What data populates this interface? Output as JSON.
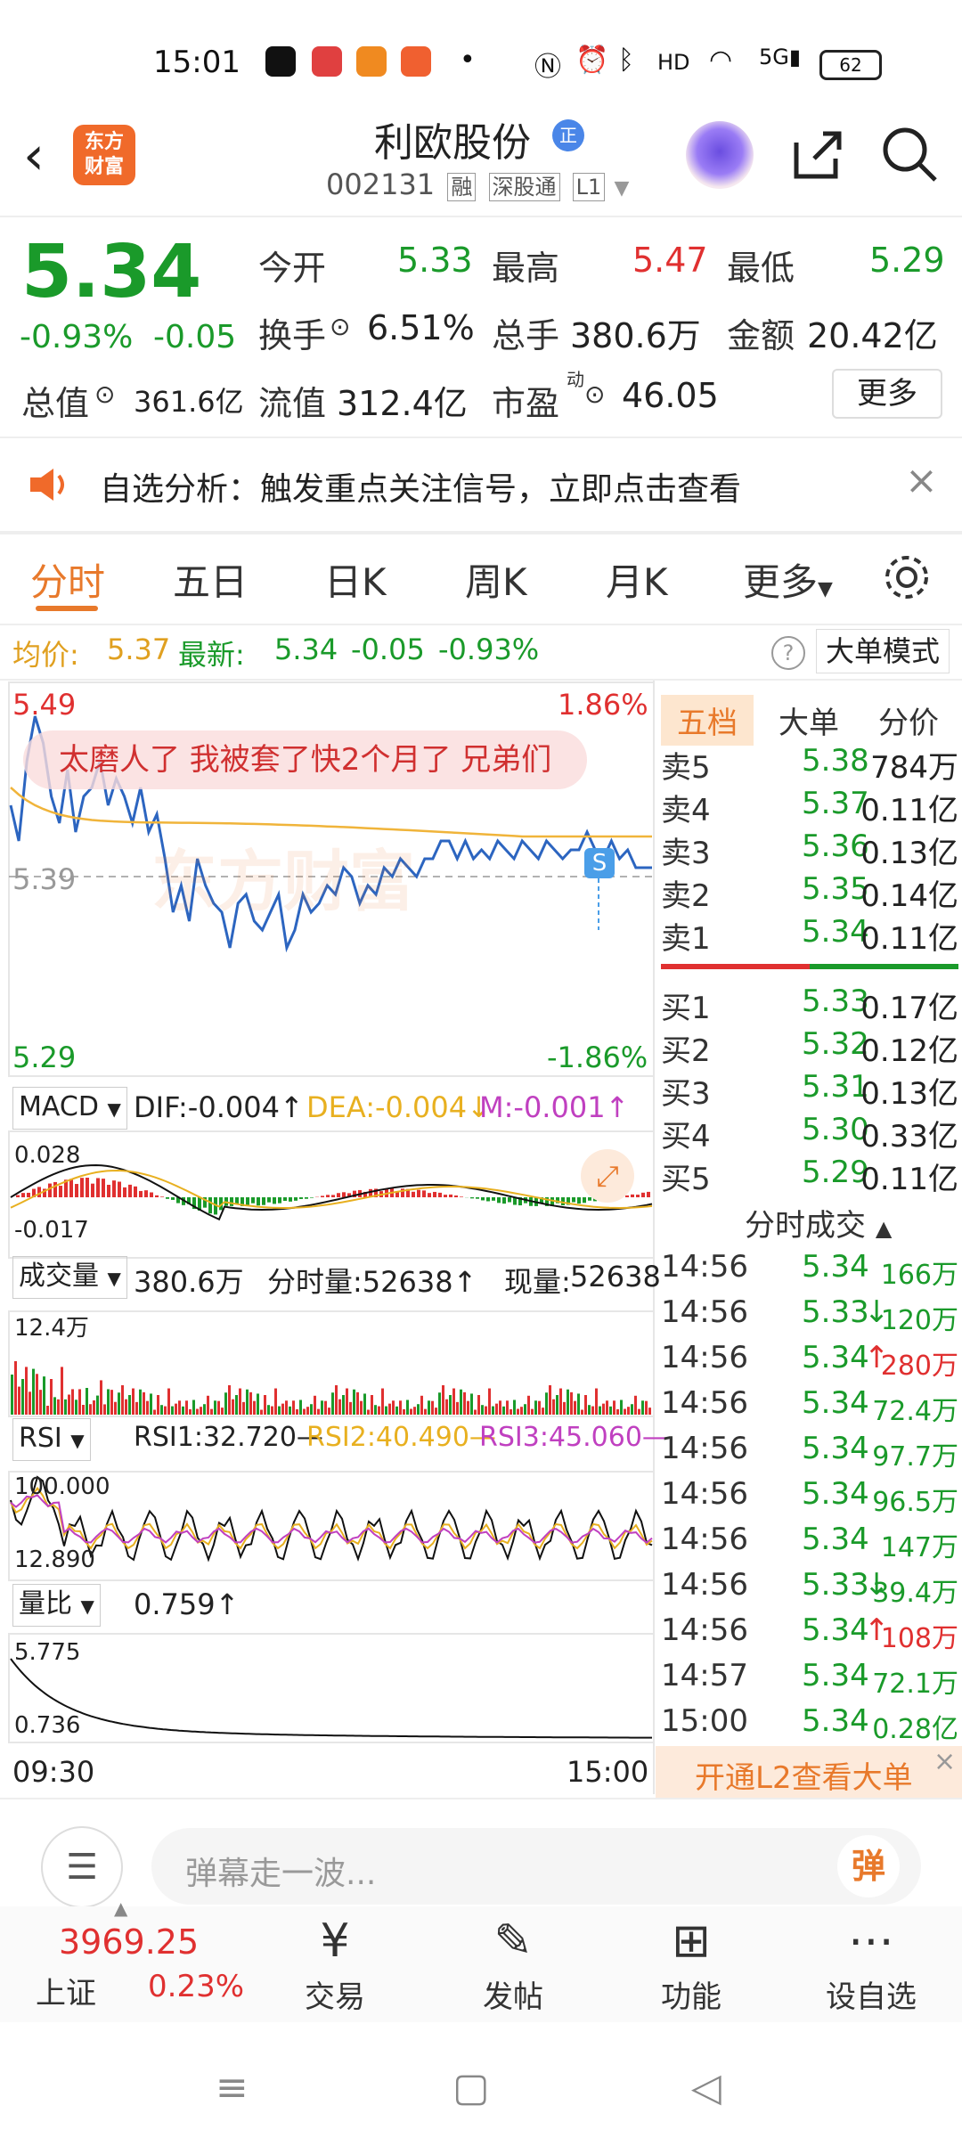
{
  "status_bar": {
    "time": "15:01",
    "battery": "62"
  },
  "header": {
    "stock_name": "利欧股份",
    "badge": "正",
    "stock_code": "002131",
    "tags": [
      "融",
      "深股通",
      "L1"
    ],
    "logo_text": "东方\n财富"
  },
  "quote": {
    "price": "5.34",
    "change_pct": "-0.93%",
    "change": "-0.05",
    "today_open_label": "今开",
    "today_open": "5.33",
    "high_label": "最高",
    "high": "5.47",
    "low_label": "最低",
    "low": "5.29",
    "turnover_label": "换手",
    "turnover": "6.51%",
    "volume_label": "总手",
    "volume": "380.6万",
    "amount_label": "金额",
    "amount": "20.42亿",
    "total_value_label": "总值",
    "total_value": "361.6亿",
    "float_value_label": "流值",
    "float_value": "312.4亿",
    "pe_label": "市盈",
    "pe_sup": "动",
    "pe": "46.05",
    "more": "更多"
  },
  "alert": {
    "text": "自选分析：触发重点关注信号，立即点击查看"
  },
  "tabs": [
    "分时",
    "五日",
    "日K",
    "周K",
    "月K",
    "更多"
  ],
  "info_line": {
    "avg_label": "均价:",
    "avg": "5.37",
    "latest_label": "最新:",
    "latest": "5.34",
    "chg": "-0.05",
    "pct": "-0.93%",
    "big_mode": "大单模式"
  },
  "chart": {
    "price_top": "5.49",
    "pct_top": "1.86%",
    "price_bottom": "5.29",
    "pct_bottom": "-1.86%",
    "mid_label": "5.39",
    "danmaku": "太磨人了 我被套了快2个月了 兄弟们",
    "watermark": "东方财富",
    "s_marker": "S",
    "time_start": "09:30",
    "time_end": "15:00"
  },
  "macd": {
    "name": "MACD",
    "dif": "DIF:-0.004",
    "dea": "DEA:-0.004",
    "m": "M:-0.001",
    "top": "0.028",
    "bottom": "-0.017"
  },
  "volume": {
    "name": "成交量",
    "total": "380.6万",
    "tick_label": "分时量:52638",
    "now_label": "现量:",
    "now": "52638",
    "top": "12.4万"
  },
  "rsi": {
    "name": "RSI",
    "rsi1": "RSI1:32.720",
    "rsi2": "RSI2:40.490",
    "rsi3": "RSI3:45.060",
    "top": "100.000",
    "bottom": "12.890"
  },
  "liangbi": {
    "name": "量比",
    "value": "0.759",
    "top": "5.775",
    "bottom": "0.736"
  },
  "panel_tabs": [
    "五档",
    "大单",
    "分价"
  ],
  "order_book": {
    "asks": [
      {
        "label": "卖5",
        "price": "5.38",
        "vol": "784万"
      },
      {
        "label": "卖4",
        "price": "5.37",
        "vol": "0.11亿"
      },
      {
        "label": "卖3",
        "price": "5.36",
        "vol": "0.13亿"
      },
      {
        "label": "卖2",
        "price": "5.35",
        "vol": "0.14亿"
      },
      {
        "label": "卖1",
        "price": "5.34",
        "vol": "0.11亿"
      }
    ],
    "bids": [
      {
        "label": "买1",
        "price": "5.33",
        "vol": "0.17亿"
      },
      {
        "label": "买2",
        "price": "5.32",
        "vol": "0.12亿"
      },
      {
        "label": "买3",
        "price": "5.31",
        "vol": "0.13亿"
      },
      {
        "label": "买4",
        "price": "5.30",
        "vol": "0.33亿"
      },
      {
        "label": "买5",
        "price": "5.29",
        "vol": "0.11亿"
      }
    ]
  },
  "trades_title": "分时成交",
  "trades": [
    {
      "time": "14:56",
      "price": "5.34",
      "arrow": "",
      "vol": "166万"
    },
    {
      "time": "14:56",
      "price": "5.33",
      "arrow": "↓",
      "vol": "120万"
    },
    {
      "time": "14:56",
      "price": "5.34",
      "arrow": "↑",
      "vol": "280万"
    },
    {
      "time": "14:56",
      "price": "5.34",
      "arrow": "",
      "vol": "72.4万"
    },
    {
      "time": "14:56",
      "price": "5.34",
      "arrow": "",
      "vol": "97.7万"
    },
    {
      "time": "14:56",
      "price": "5.34",
      "arrow": "",
      "vol": "96.5万"
    },
    {
      "time": "14:56",
      "price": "5.34",
      "arrow": "",
      "vol": "147万"
    },
    {
      "time": "14:56",
      "price": "5.33",
      "arrow": "↓",
      "vol": "39.4万"
    },
    {
      "time": "14:56",
      "price": "5.34",
      "arrow": "↑",
      "vol": "108万"
    },
    {
      "time": "14:57",
      "price": "5.34",
      "arrow": "",
      "vol": "72.1万"
    },
    {
      "time": "15:00",
      "price": "5.34",
      "arrow": "",
      "vol": "0.28亿"
    }
  ],
  "l2_banner": "开通L2查看大单",
  "danmu_placeholder": "弹幕走一波...",
  "danmu_btn": "弹",
  "index": {
    "value": "3969.25",
    "name": "上证",
    "pct": "0.23%"
  },
  "bottom_nav": [
    {
      "label": "交易",
      "icon": "trade-icon"
    },
    {
      "label": "发帖",
      "icon": "edit-icon"
    },
    {
      "label": "功能",
      "icon": "grid-icon"
    },
    {
      "label": "设自选",
      "icon": "more-dots-icon"
    }
  ],
  "colors": {
    "up": "#e03030",
    "down": "#1a9a2a",
    "accent": "#e8792b",
    "price_line": "#2c65c0",
    "avg_line": "#f0b43a"
  }
}
